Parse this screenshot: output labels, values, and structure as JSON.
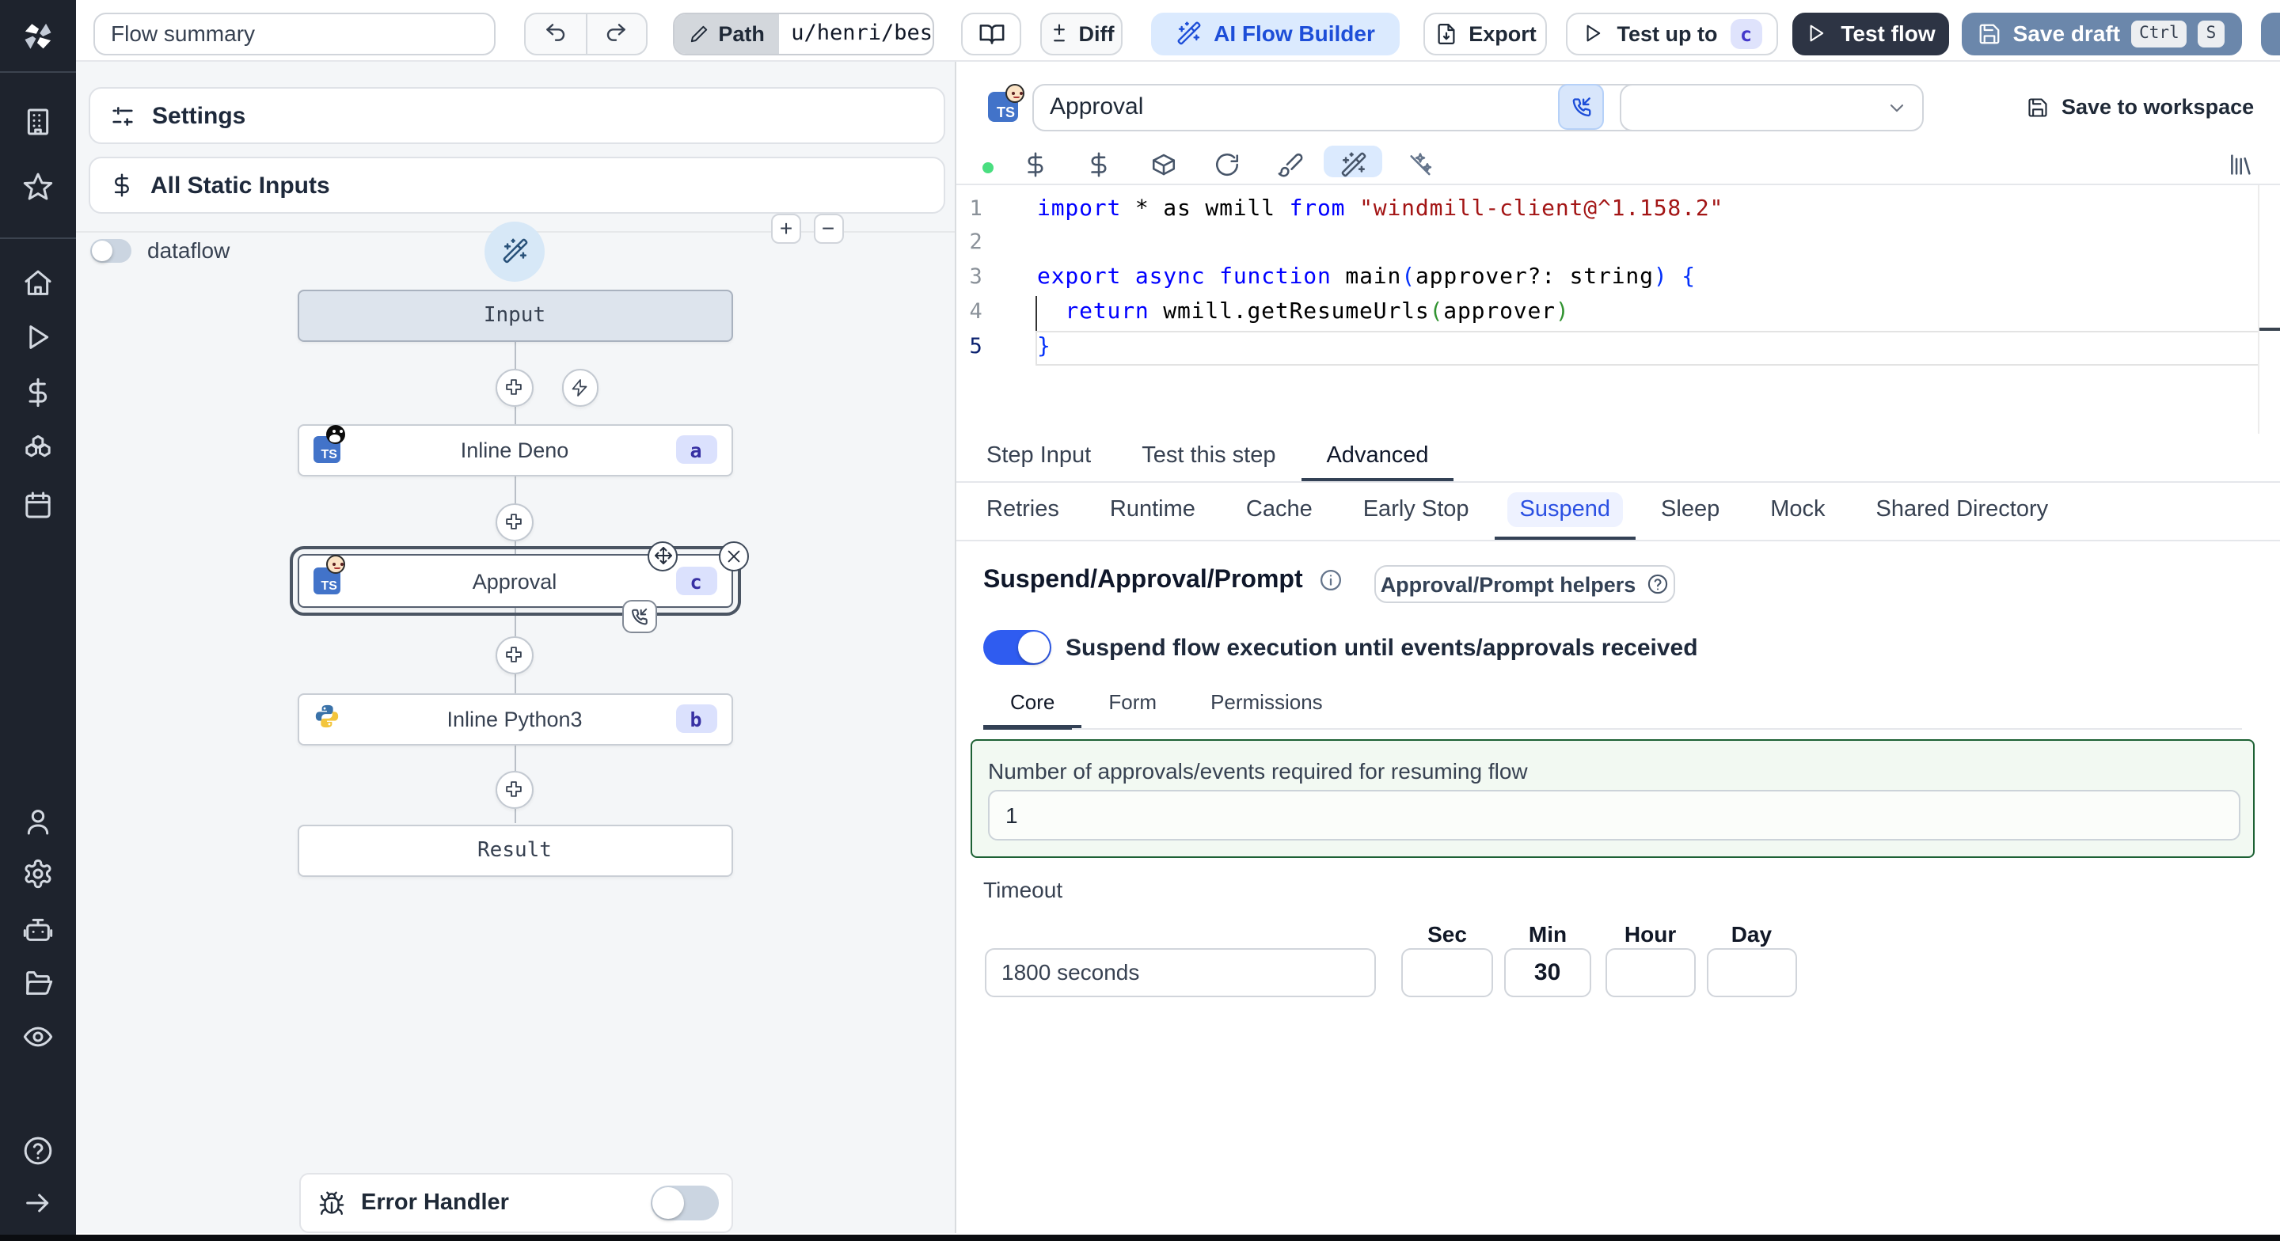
{
  "colors": {
    "accent_blue": "#1d4ed8",
    "toggle_on_blue": "#2f5cf0",
    "save_draft_blue": "#6b87ab",
    "test_flow_dark": "#2d3444",
    "suspend_tab_blue": "#2b50e2",
    "green_border": "#1d6134",
    "sidebar_dark": "#1e232d",
    "badge_indigo_bg": "#dbe1fd",
    "status_dot_green": "#4ade80"
  },
  "topbar": {
    "flow_summary_placeholder": "Flow summary",
    "path": {
      "label": "Path",
      "value": "u/henri/bes"
    },
    "diff_label": "Diff",
    "ai_flow_builder_label": "AI Flow Builder",
    "export_label": "Export",
    "test_up_to": {
      "label": "Test up to",
      "badge": "c"
    },
    "test_flow_label": "Test flow",
    "save_draft": {
      "label": "Save draft",
      "kbd_ctrl": "Ctrl",
      "kbd_s": "S"
    }
  },
  "flow_panel": {
    "settings_label": "Settings",
    "all_static_inputs_label": "All Static Inputs",
    "dataflow_label": "dataflow",
    "zoom_in_label": "+",
    "zoom_out_label": "−",
    "nodes": {
      "input_label": "Input",
      "deno": {
        "title": "Inline Deno",
        "badge": "a",
        "language": "TS"
      },
      "approval": {
        "title": "Approval",
        "badge": "c",
        "language": "TS"
      },
      "python": {
        "title": "Inline Python3",
        "badge": "b"
      },
      "result_label": "Result"
    },
    "error_handler_label": "Error Handler"
  },
  "editor_header": {
    "language_badge": "TS",
    "step_name": "Approval",
    "save_to_workspace_label": "Save to workspace"
  },
  "code_lines": [
    {
      "num": "1",
      "t0": "import",
      "t1": " * as wmill ",
      "t2": "from",
      "t3": " ",
      "t4": "\"windmill-client@^1.158.2\""
    },
    {
      "num": "2"
    },
    {
      "num": "3",
      "t0": "export",
      "t1": " ",
      "t2": "async",
      "t3": " ",
      "t4": "function",
      "t5": " main",
      "t6": "(",
      "t7": "approver?: string",
      "t8": ")",
      "t9": " ",
      "t10": "{"
    },
    {
      "num": "4",
      "t0": "  ",
      "t1": "return",
      "t2": " wmill.getResumeUrls",
      "t3": "(",
      "t4": "approver",
      "t5": ")"
    },
    {
      "num": "5",
      "t0": "}"
    }
  ],
  "step_tabs": {
    "step_input": "Step Input",
    "test_this_step": "Test this step",
    "advanced": "Advanced"
  },
  "advanced_tabs": {
    "retries": "Retries",
    "runtime": "Runtime",
    "cache": "Cache",
    "early_stop": "Early Stop",
    "suspend": "Suspend",
    "sleep": "Sleep",
    "mock": "Mock",
    "shared_directory": "Shared Directory"
  },
  "suspend_section": {
    "title": "Suspend/Approval/Prompt",
    "helpers_button_label": "Approval/Prompt helpers",
    "toggle_label": "Suspend flow execution until events/approvals received",
    "tabs": {
      "core": "Core",
      "form": "Form",
      "permissions": "Permissions"
    },
    "approvals_required": {
      "label": "Number of approvals/events required for resuming flow",
      "value": "1"
    },
    "timeout": {
      "label": "Timeout",
      "total_value": "1800 seconds",
      "sec_label": "Sec",
      "min_label": "Min",
      "hour_label": "Hour",
      "day_label": "Day",
      "sec_value": "",
      "min_value": "30",
      "hour_value": "",
      "day_value": ""
    }
  }
}
